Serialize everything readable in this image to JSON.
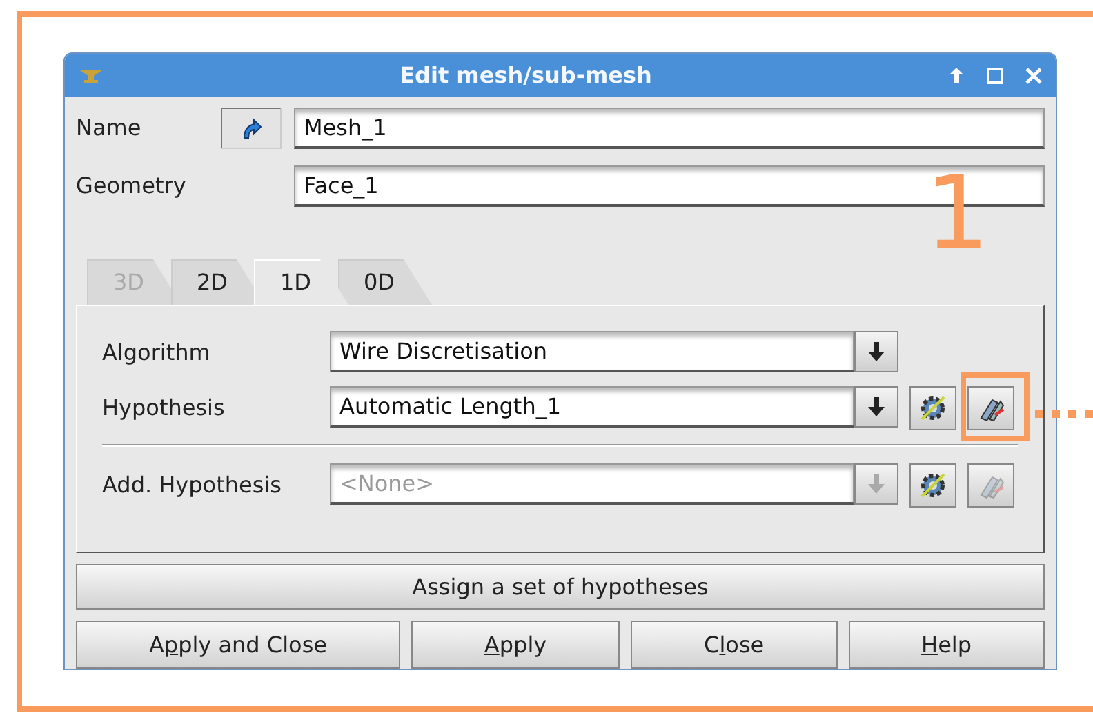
{
  "window": {
    "title": "Edit mesh/sub-mesh"
  },
  "fields": [
    {
      "label": "Name",
      "value": "Mesh_1",
      "select_button": true
    },
    {
      "label": "Geometry",
      "value": "Face_1",
      "select_button": false
    }
  ],
  "tabs": [
    {
      "label": "3D",
      "selected": false,
      "disabled": true
    },
    {
      "label": "2D",
      "selected": false,
      "disabled": false
    },
    {
      "label": "1D",
      "selected": true,
      "disabled": false
    },
    {
      "label": "0D",
      "selected": false,
      "disabled": false
    }
  ],
  "rows": [
    {
      "kind": "algorithm",
      "label": "Algorithm",
      "value": "Wire Discretisation",
      "disabled": false
    },
    {
      "kind": "hypothesis",
      "label": "Hypothesis",
      "value": "Automatic Length_1",
      "disabled": false,
      "edit_enabled": true
    },
    {
      "kind": "additional",
      "label": "Add. Hypothesis",
      "value": "<None>",
      "disabled": true,
      "edit_enabled": false
    }
  ],
  "assign_button": "Assign a set of hypotheses",
  "buttons": [
    {
      "before": "A",
      "key": "p",
      "after": "ply and Close"
    },
    {
      "key": "A",
      "after": "pply"
    },
    {
      "before": "C",
      "key": "l",
      "after": "ose"
    },
    {
      "key": "H",
      "after": "elp"
    }
  ],
  "annotation": {
    "label": "1"
  }
}
